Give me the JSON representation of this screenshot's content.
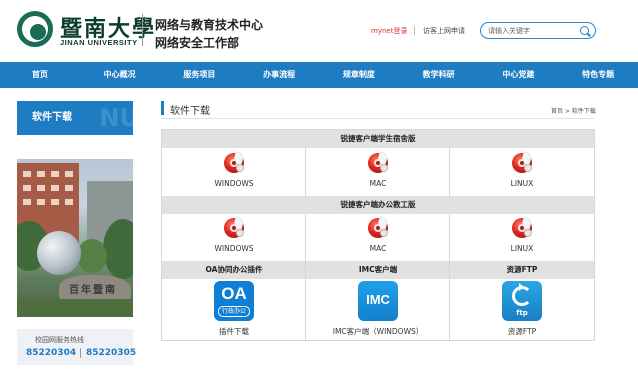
{
  "header": {
    "logo_cn": "暨南大學",
    "logo_en": "JINAN UNIVERSITY",
    "subtitle_line1": "网络与教育技术中心",
    "subtitle_line2": "网络安全工作部",
    "mynet_login": "mynet登录",
    "visitor_apply": "访客上网申请",
    "search_placeholder": "请输入关键字"
  },
  "nav": [
    "首页",
    "中心概况",
    "服务项目",
    "办事流程",
    "规章制度",
    "教学科研",
    "中心党建",
    "特色专题"
  ],
  "sidebar": {
    "title": "软件下载",
    "ghost": "NU",
    "photo_text": "百年暨南",
    "hotline_label": "校园网服务热线",
    "hotline_1": "85220304",
    "hotline_2": "85220305"
  },
  "main": {
    "title": "软件下载",
    "breadcrumb": "首页 > 软件下载",
    "sections": [
      {
        "heading": "锐捷客户端学生宿舍版",
        "items": [
          {
            "label": "WINDOWS",
            "icon": "ruijie-client-icon"
          },
          {
            "label": "MAC",
            "icon": "ruijie-client-icon"
          },
          {
            "label": "LINUX",
            "icon": "ruijie-client-icon"
          }
        ]
      },
      {
        "heading": "锐捷客户端办公教工版",
        "items": [
          {
            "label": "WINDOWS",
            "icon": "ruijie-client-icon"
          },
          {
            "label": "MAC",
            "icon": "ruijie-client-icon"
          },
          {
            "label": "LINUX",
            "icon": "ruijie-client-icon"
          }
        ]
      }
    ],
    "apps": [
      {
        "heading": "OA协同办公插件",
        "icon_text": "OA",
        "icon_sub": "行政办公",
        "label": "插件下载"
      },
      {
        "heading": "IMC客户端",
        "icon_text": "IMC",
        "label": "IMC客户端（WINDOWS）"
      },
      {
        "heading": "资源FTP",
        "icon_text": "ftp",
        "label": "资源FTP"
      }
    ]
  },
  "colors": {
    "brand_blue": "#1e7cc2",
    "login_red": "#d33333",
    "logo_green": "#1b6b55"
  }
}
